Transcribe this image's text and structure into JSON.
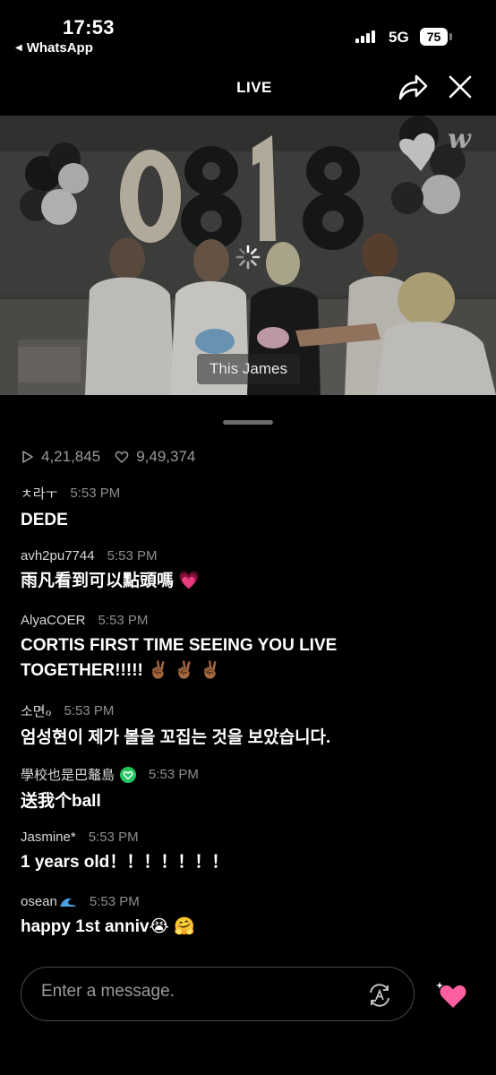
{
  "status_bar": {
    "time": "17:53",
    "back_app": "WhatsApp",
    "network": "5G",
    "battery": "75"
  },
  "header": {
    "title": "LIVE",
    "share_icon": "share-arrow-icon",
    "close_icon": "close-icon"
  },
  "video": {
    "balloon_text": "0818",
    "caption": "This James",
    "watermark": "w"
  },
  "stats": {
    "views": "4,21,845",
    "likes": "9,49,374"
  },
  "comments": [
    {
      "user": "ㅊ라ㅜ",
      "time": "5:53 PM",
      "text": "DEDE"
    },
    {
      "user": "avh2pu7744",
      "time": "5:53 PM",
      "text": "雨凡看到可以點頭嗎",
      "emoji": "💗"
    },
    {
      "user": "AlyaCOER",
      "time": "5:53 PM",
      "text": "CORTIS FIRST TIME SEEING YOU LIVE TOGETHER!!!!!",
      "emoji": "✌🏾 ✌🏾 ✌🏾"
    },
    {
      "user": "소면ℴ",
      "time": "5:53 PM",
      "text": "엄성현이 제가 볼을 꼬집는 것을 보았습니다."
    },
    {
      "user": "學校也是巴鼇島",
      "time": "5:53 PM",
      "text": "送我个ball",
      "badge": "verified-heart-badge"
    },
    {
      "user": "Jasmine*",
      "time": "5:53 PM",
      "text": "1 years old！！！！！！！"
    },
    {
      "user": "osean",
      "time": "5:53 PM",
      "text": "happy 1st anniv",
      "emoji": "😭 🤗",
      "user_emoji": "wave-icon"
    }
  ],
  "input": {
    "placeholder": "Enter a message.",
    "translate_icon": "translate-icon",
    "heart_icon": "sparkle-heart-icon"
  },
  "colors": {
    "background": "#000000",
    "accent_heart": "#ff5fa2",
    "badge_green": "#22c55e"
  }
}
